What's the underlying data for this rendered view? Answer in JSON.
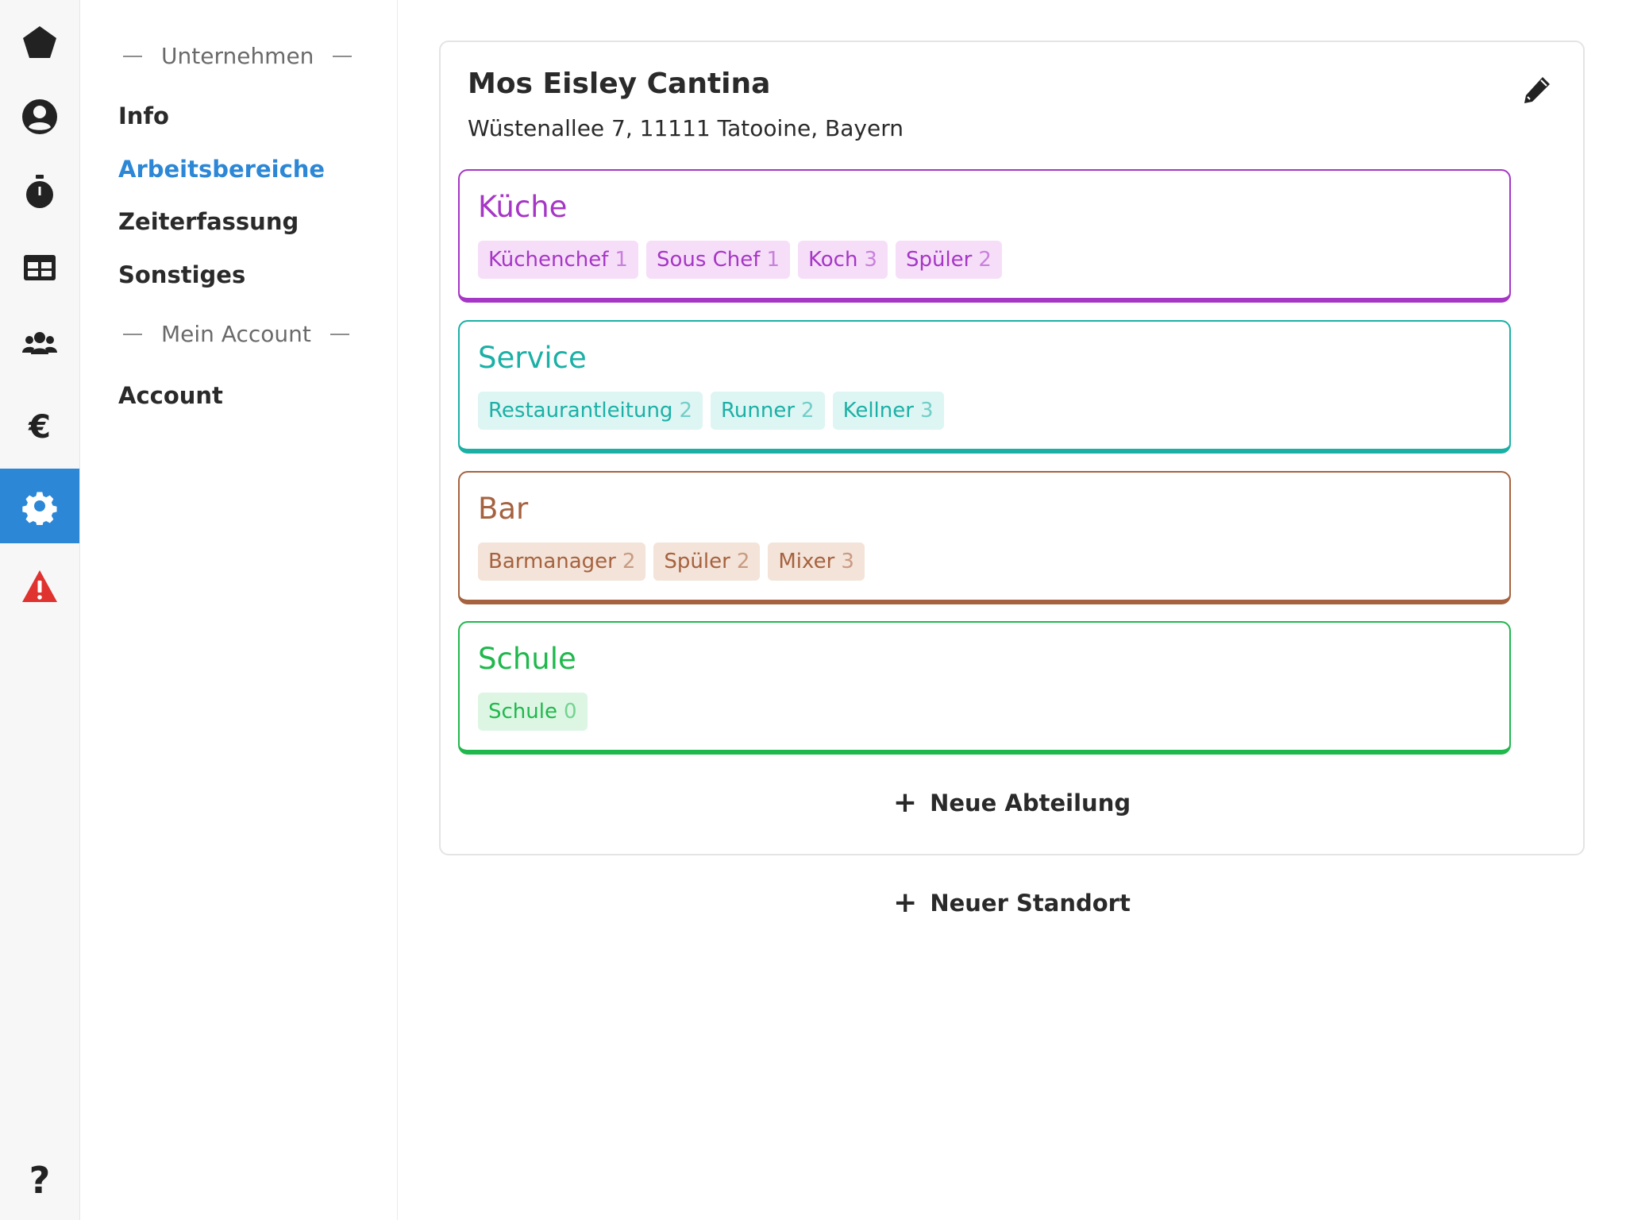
{
  "rail": {
    "items": [
      {
        "icon": "pentagon-icon",
        "active": false
      },
      {
        "icon": "user-icon",
        "active": false
      },
      {
        "icon": "stopwatch-icon",
        "active": false
      },
      {
        "icon": "table-icon",
        "active": false
      },
      {
        "icon": "users-icon",
        "active": false
      },
      {
        "icon": "euro-icon",
        "active": false
      },
      {
        "icon": "gear-icon",
        "active": true
      },
      {
        "icon": "warning-icon",
        "active": false
      },
      {
        "icon": "question-icon",
        "active": false
      }
    ],
    "accent": "#2c87d6",
    "warning_color": "#e0322f"
  },
  "subnav": {
    "section_company": "Unternehmen",
    "info": "Info",
    "workareas": "Arbeitsbereiche",
    "timetracking": "Zeiterfassung",
    "misc": "Sonstiges",
    "section_account": "Mein Account",
    "account": "Account"
  },
  "location": {
    "name": "Mos Eisley Cantina",
    "address": "Wüstenallee 7, 11111 Tatooine, Bayern",
    "departments": [
      {
        "name": "Küche",
        "color": "#a636c6",
        "tag_bg": "#f6def9",
        "positions": [
          {
            "label": "Küchenchef",
            "count": "1"
          },
          {
            "label": "Sous Chef",
            "count": "1"
          },
          {
            "label": "Koch",
            "count": "3"
          },
          {
            "label": "Spüler",
            "count": "2"
          }
        ]
      },
      {
        "name": "Service",
        "color": "#1bb0a6",
        "tag_bg": "#ddf5f3",
        "positions": [
          {
            "label": "Restaurantleitung",
            "count": "2"
          },
          {
            "label": "Runner",
            "count": "2"
          },
          {
            "label": "Kellner",
            "count": "3"
          }
        ]
      },
      {
        "name": "Bar",
        "color": "#a6623f",
        "tag_bg": "#f3e3d8",
        "positions": [
          {
            "label": "Barmanager",
            "count": "2"
          },
          {
            "label": "Spüler",
            "count": "2"
          },
          {
            "label": "Mixer",
            "count": "3"
          }
        ]
      },
      {
        "name": "Schule",
        "color": "#1fb84c",
        "tag_bg": "#ddf6e4",
        "positions": [
          {
            "label": "Schule",
            "count": "0"
          }
        ]
      }
    ],
    "new_department": "Neue Abteilung"
  },
  "new_location": "Neuer Standort"
}
